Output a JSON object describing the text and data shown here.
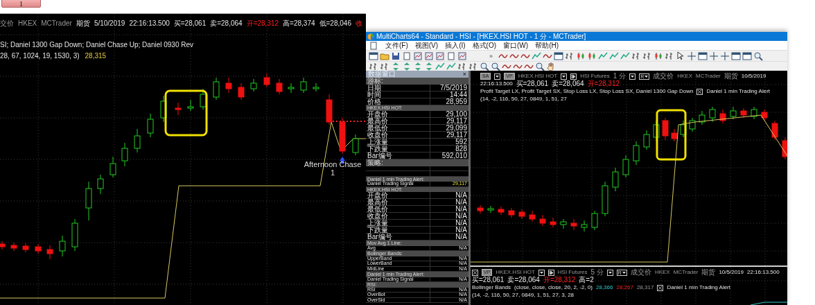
{
  "left_window": {
    "tab_label": "1",
    "header": [
      {
        "kind": "muted",
        "text": "交价"
      },
      {
        "kind": "muted",
        "text": "HKEX"
      },
      {
        "kind": "muted",
        "text": "MCTrader"
      },
      {
        "kind": "plain",
        "text": "期货"
      },
      {
        "kind": "plain",
        "text": "5/10/2019"
      },
      {
        "kind": "plain",
        "text": "22:16:13.500"
      },
      {
        "kind": "plain",
        "text": "买=28,061"
      },
      {
        "kind": "plain",
        "text": "卖=28,064"
      },
      {
        "kind": "alert",
        "text": "开=28,312"
      },
      {
        "kind": "plain",
        "text": "高=28,374"
      },
      {
        "kind": "plain",
        "text": "低=28,046"
      },
      {
        "kind": "alert",
        "text": "收"
      }
    ],
    "study_line": [
      {
        "kind": "plain",
        "text": "SI; Daniel 1300 Gap Down; Daniel Chase Up; Daniel 0930 Rev"
      }
    ],
    "params_line": [
      {
        "kind": "plain",
        "text": "28, 67, 1024, 19, 1530, 3)"
      },
      {
        "kind": "yellow",
        "text": "28,315"
      }
    ],
    "marker": {
      "label": "Afternoon Chase",
      "count": "1"
    }
  },
  "app_window": {
    "title": "MultiCharts64 - Standard - HSI - [HKEX.HSI HOT - 1 分 - MCTrader]",
    "menu": [
      "文件(F)",
      "视图(V)",
      "插入(I)",
      "格式(O)",
      "窗口(W)",
      "帮助(H)"
    ],
    "toolbar_overflow": "»",
    "data_window": {
      "title": "数据窗口",
      "close": "×",
      "rows": [
        {
          "kind": "section",
          "label": "游标:"
        },
        {
          "kind": "row",
          "label": "日期",
          "value": "7/5/2019"
        },
        {
          "kind": "row",
          "label": "时间",
          "value": "14:44"
        },
        {
          "kind": "row",
          "label": "价格",
          "value": "28,959"
        },
        {
          "kind": "section",
          "label": "HKEX.HSI HOT:"
        },
        {
          "kind": "row",
          "label": "开盘价",
          "value": "29,100"
        },
        {
          "kind": "row",
          "label": "最高价",
          "value": "29,117"
        },
        {
          "kind": "row",
          "label": "最低价",
          "value": "29,099"
        },
        {
          "kind": "row",
          "label": "收盘价",
          "value": "29,117"
        },
        {
          "kind": "row",
          "label": "上涨量",
          "value": "592"
        },
        {
          "kind": "row",
          "label": "下跌量",
          "value": "828"
        },
        {
          "kind": "row",
          "label": "Bar编号",
          "value": "592,010"
        },
        {
          "kind": "section",
          "label": "策略:"
        },
        {
          "kind": "empty"
        },
        {
          "kind": "empty"
        },
        {
          "kind": "section",
          "label": "Daniel 1 min Trading Alert:"
        },
        {
          "kind": "signal",
          "label": "Daniel Trading Signal",
          "value": "29,117"
        },
        {
          "kind": "section",
          "label": "HKEX.HSI HOT:"
        },
        {
          "kind": "row",
          "label": "开盘价",
          "value": "N/A"
        },
        {
          "kind": "row",
          "label": "最高价",
          "value": "N/A"
        },
        {
          "kind": "row",
          "label": "最低价",
          "value": "N/A"
        },
        {
          "kind": "row",
          "label": "收盘价",
          "value": "N/A"
        },
        {
          "kind": "row",
          "label": "上涨量",
          "value": "N/A"
        },
        {
          "kind": "row",
          "label": "下跌量",
          "value": "N/A"
        },
        {
          "kind": "row",
          "label": "Bar编号",
          "value": "N/A"
        },
        {
          "kind": "section",
          "label": "Mov Avg 1 Line:"
        },
        {
          "kind": "row",
          "label": "Avg",
          "value": "N/A"
        },
        {
          "kind": "section",
          "label": "Bollinger Bands:"
        },
        {
          "kind": "row",
          "label": "UpperBand",
          "value": "N/A"
        },
        {
          "kind": "row",
          "label": "LowerBand",
          "value": "N/A"
        },
        {
          "kind": "row",
          "label": "MidLine",
          "value": "N/A"
        },
        {
          "kind": "section",
          "label": "Daniel 1 min Trading Alert:"
        },
        {
          "kind": "row",
          "label": "Daniel Trading Signal",
          "value": "N/A"
        },
        {
          "kind": "section",
          "label": "RSI:"
        },
        {
          "kind": "row",
          "label": "RSI",
          "value": "N/A"
        },
        {
          "kind": "row",
          "label": "OverBot",
          "value": "N/A"
        },
        {
          "kind": "row",
          "label": "OverSld",
          "value": "N/A"
        }
      ]
    },
    "chart": {
      "header": [
        {
          "kind": "badge",
          "text": "SA"
        },
        {
          "kind": "dropdown"
        },
        {
          "kind": "badge",
          "text": "VP"
        },
        {
          "kind": "muted",
          "text": "HKEX.HSI HOT"
        },
        {
          "kind": "dropdown"
        },
        {
          "kind": "datafeed"
        },
        {
          "kind": "muted",
          "text": "HSI Futures"
        },
        {
          "kind": "muted",
          "text": "1 分"
        },
        {
          "kind": "dropdown"
        },
        {
          "kind": "boxed",
          "text": "R"
        },
        {
          "kind": "muted",
          "text": "成交价"
        },
        {
          "kind": "muted",
          "text": "HKEX"
        },
        {
          "kind": "muted",
          "text": "MCTrader"
        },
        {
          "kind": "muted",
          "text": "期货"
        },
        {
          "kind": "plain",
          "text": "10/5/2019"
        },
        {
          "kind": "plain",
          "text": "22:16:13.500"
        },
        {
          "kind": "plain",
          "text": "买=28,061"
        },
        {
          "kind": "plain",
          "text": "卖=28,064"
        },
        {
          "kind": "alert",
          "text": "开=28,312"
        }
      ],
      "study_line": [
        {
          "kind": "plain",
          "text": "Profit Target LX, Profit Target SX, Stop Loss LX, Stop Loss SX, Daniel 1300 Gap Down"
        },
        {
          "kind": "close"
        },
        {
          "kind": "plain",
          "text": "Daniel 1 min Trading Alert"
        },
        {
          "kind": "plain",
          "text": "(14, -2, 116, 50, 27, 0849, 1, 51, 27"
        }
      ]
    },
    "sub_pane": {
      "header": [
        {
          "kind": "close"
        },
        {
          "kind": "badge",
          "text": "VP"
        },
        {
          "kind": "muted",
          "text": "HKEX.HSI HOT"
        },
        {
          "kind": "dropdown"
        },
        {
          "kind": "datafeed"
        },
        {
          "kind": "muted",
          "text": "HSI Futures"
        },
        {
          "kind": "muted",
          "text": "5 分"
        },
        {
          "kind": "dropdown"
        },
        {
          "kind": "boxed",
          "text": "R"
        },
        {
          "kind": "muted",
          "text": "成交价"
        },
        {
          "kind": "muted",
          "text": "HKEX"
        },
        {
          "kind": "muted",
          "text": "MCTrader"
        },
        {
          "kind": "muted",
          "text": "期货"
        },
        {
          "kind": "plain",
          "text": "10/5/2019"
        },
        {
          "kind": "plain",
          "text": "22:16:13.500"
        },
        {
          "kind": "plain",
          "text": "买=28,061"
        },
        {
          "kind": "plain",
          "text": "卖=28,064"
        },
        {
          "kind": "alert",
          "text": "开=28,312"
        },
        {
          "kind": "plain",
          "text": "高=2"
        }
      ],
      "study_line": [
        {
          "kind": "plain",
          "text": "Bollinger Bands"
        },
        {
          "kind": "plain",
          "text": "(close, close, close, 20, 2, -2, 0)"
        },
        {
          "kind": "cyan",
          "text": "28,366"
        },
        {
          "kind": "alert",
          "text": "28,267"
        },
        {
          "kind": "muted",
          "text": "28,317"
        },
        {
          "kind": "close"
        },
        {
          "kind": "plain",
          "text": "Daniel 1 min Trading Alert"
        },
        {
          "kind": "plain",
          "text": "(14, -2, 116, 50, 27, 0849, 1, 51, 27, 3, 28"
        }
      ]
    }
  }
}
